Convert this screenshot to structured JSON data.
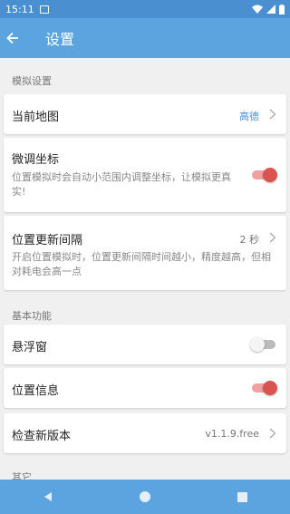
{
  "status_bar": {
    "time": "15:11"
  },
  "toolbar": {
    "title": "设置"
  },
  "sections": {
    "sim": "模拟设置",
    "basic": "基本功能",
    "other": "其它"
  },
  "items": {
    "current_map": {
      "title": "当前地图",
      "value": "高德"
    },
    "fine_tune": {
      "title": "微调坐标",
      "desc": "位置模拟时会自动小范围内调整坐标，让模拟更真实!",
      "enabled": true
    },
    "update_interval": {
      "title": "位置更新间隔",
      "value": "2 秒",
      "desc": "开启位置模拟时，位置更新间隔时间越小，精度越高，但相对耗电会高一点"
    },
    "floating_window": {
      "title": "悬浮窗",
      "enabled": false
    },
    "location_info": {
      "title": "位置信息",
      "enabled": true
    },
    "check_update": {
      "title": "检查新版本",
      "value": "v1.1.9.free"
    }
  },
  "colors": {
    "primary": "#5ba4e0",
    "accent": "#d9534f"
  }
}
